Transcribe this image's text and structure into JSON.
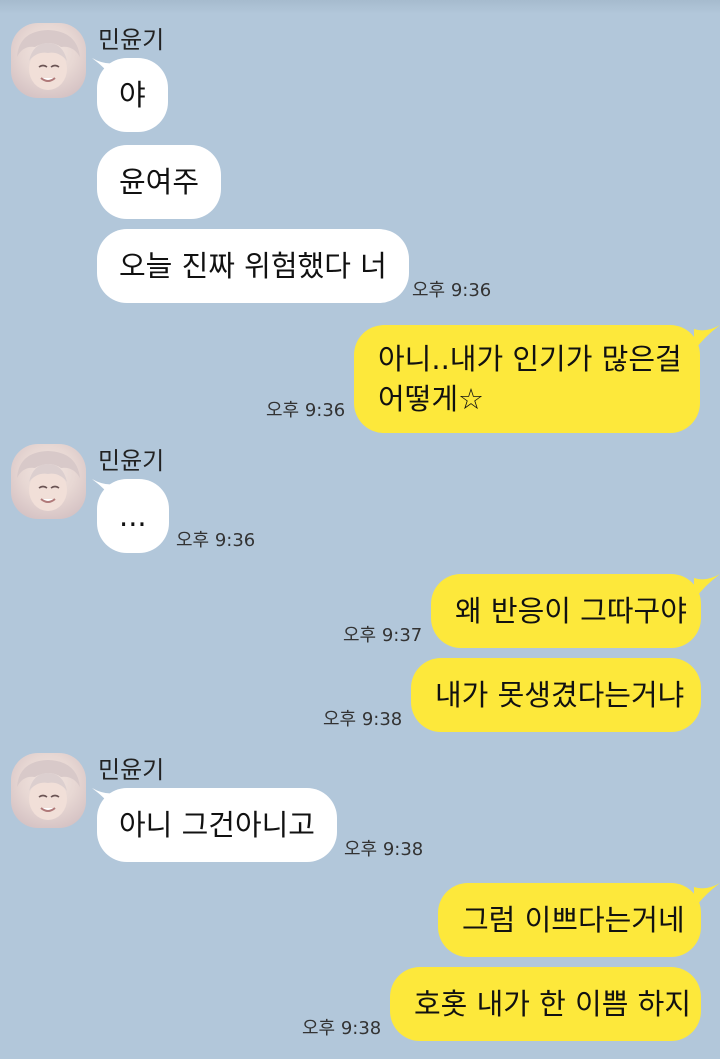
{
  "sender": {
    "name": "민윤기"
  },
  "messages": {
    "m1": "야",
    "m2": "윤여주",
    "m3": "오늘 진짜 위험했다 너",
    "m3_time": "오후 9:36",
    "m4_line1": "아니..내가 인기가 많은걸",
    "m4_line2": "어떻게☆",
    "m4_time": "오후 9:36",
    "m5": "...",
    "m5_time": "오후 9:36",
    "m6": "왜 반응이 그따구야",
    "m6_time": "오후 9:37",
    "m7": "내가 못생겼다는거냐",
    "m7_time": "오후 9:38",
    "m8": "아니 그건아니고",
    "m8_time": "오후 9:38",
    "m9": "그럼 이쁘다는거네",
    "m10": "호홋 내가 한 이쁨 하지",
    "m10_time": "오후 9:38"
  },
  "colors": {
    "background": "#b2c7da",
    "sent_bubble": "#fde83b",
    "received_bubble": "#ffffff"
  }
}
